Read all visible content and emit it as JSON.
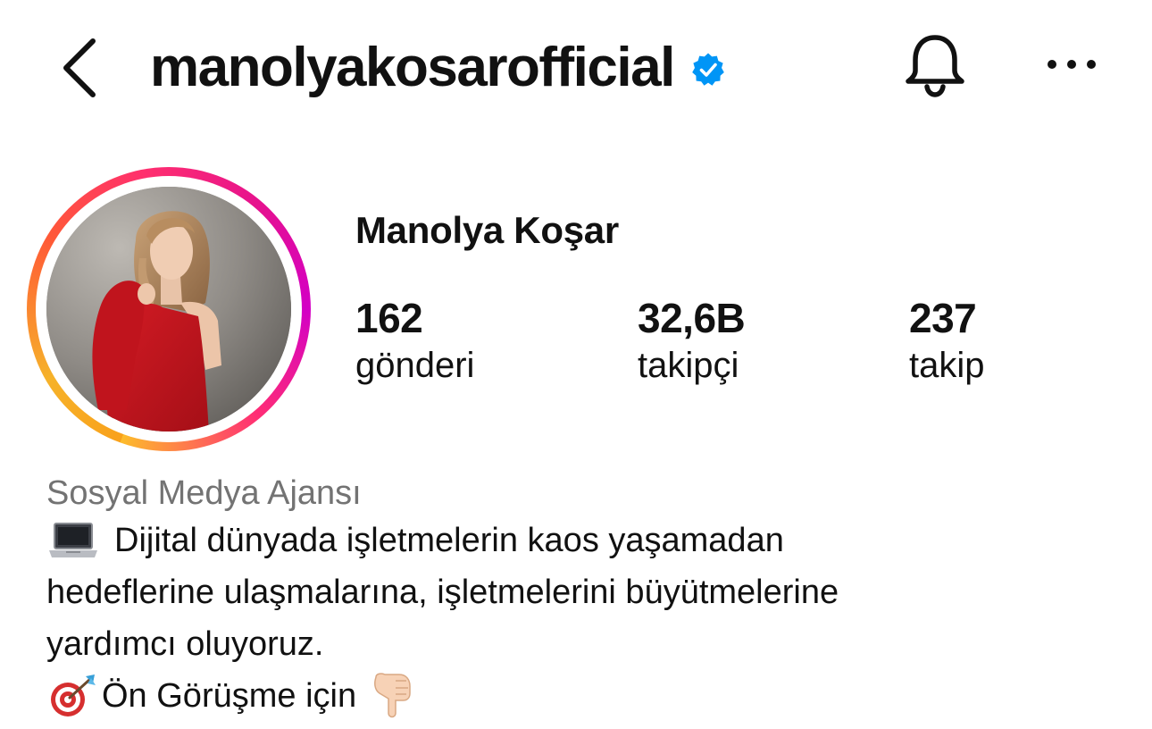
{
  "header": {
    "username": "manolyakosarofficial",
    "back_icon": "chevron-left-icon",
    "verified_icon": "verified-badge-icon",
    "bell_icon": "bell-icon",
    "more_icon": "more-horizontal-icon",
    "verified_color": "#0095f6"
  },
  "profile": {
    "display_name": "Manolya Koşar",
    "stats": {
      "posts": {
        "value": "162",
        "label": "gönderi"
      },
      "followers": {
        "value": "32,6B",
        "label": "takipçi"
      },
      "following": {
        "value": "237",
        "label": "takip"
      }
    }
  },
  "bio": {
    "category": "Sosyal Medya Ajansı",
    "line1": "Dijital dünyada işletmelerin kaos yaşamadan",
    "line2": "hedeflerine ulaşmalarına, işletmelerini büyütmelerine",
    "line3": "yardımcı oluyoruz.",
    "line4": "Ön Görüşme için",
    "icons": [
      "laptop-emoji-icon",
      "target-emoji-icon",
      "pointing-down-emoji-icon"
    ]
  },
  "colors": {
    "text_primary": "#111111",
    "text_secondary": "#737373",
    "story_ring": [
      "#fdbc2b",
      "#ff5a36",
      "#e6128e",
      "#d300c5"
    ]
  }
}
